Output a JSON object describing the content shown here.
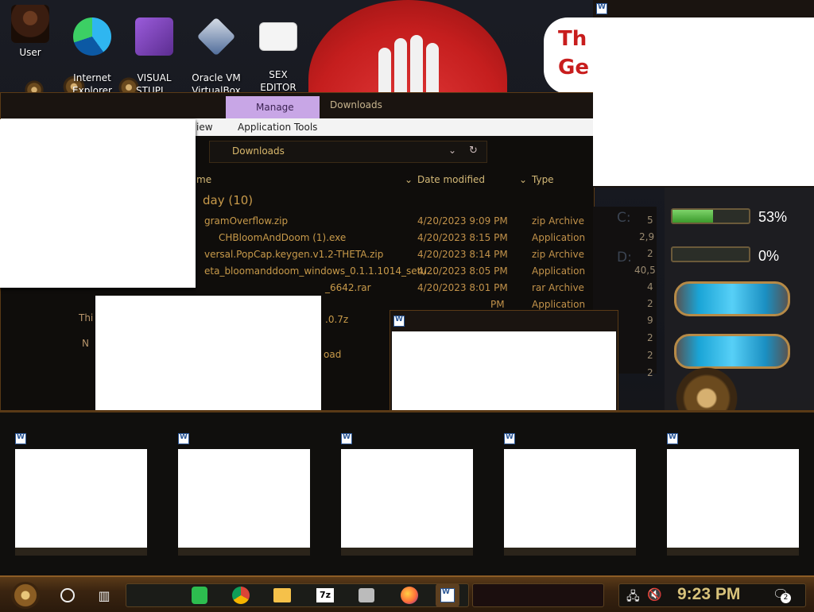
{
  "desktop": {
    "icons": [
      {
        "label": "User",
        "icon": "user-icon"
      },
      {
        "label": "Internet\nExplorer",
        "icon": "edge-icon"
      },
      {
        "label": "VISUAL\nSTUPI...",
        "icon": "visual-studio-icon"
      },
      {
        "label": "Oracle VM\nVirtualBox",
        "icon": "virtualbox-icon"
      },
      {
        "label": "SEX\nEDITOR",
        "icon": "hxd-icon"
      }
    ],
    "sign_text_1": "Th",
    "sign_text_2": "Ge"
  },
  "explorer": {
    "ribbon": {
      "manage_tab": "Manage",
      "downloads_tab": "Downloads",
      "view_tab": "iew",
      "app_tools_tab": "Application Tools"
    },
    "address": {
      "path": "Downloads"
    },
    "columns": {
      "name": "me",
      "date": "Date modified",
      "type": "Type"
    },
    "group_header": "day (10)",
    "files": [
      {
        "name": "gramOverflow.zip",
        "date": "4/20/2023 9:09 PM",
        "type": "zip Archive",
        "size": "5"
      },
      {
        "name": "CHBloomAndDoom (1).exe",
        "date": "4/20/2023 8:15 PM",
        "type": "Application",
        "size": "2,9"
      },
      {
        "name": "versal.PopCap.keygen.v1.2-THETA.zip",
        "date": "4/20/2023 8:14 PM",
        "type": "zip Archive",
        "size": "2"
      },
      {
        "name": "eta_bloomanddoom_windows_0.1.1.1014_setu...",
        "date": "4/20/2023 8:05 PM",
        "type": "Application",
        "size": "40,5"
      },
      {
        "name": "_6642.rar",
        "date": "4/20/2023 8:01 PM",
        "type": "rar Archive",
        "size": "4"
      },
      {
        "name": "",
        "date": "PM",
        "type": "Application",
        "size": "2"
      }
    ],
    "extra_rows": [
      {
        "name": ".0.7z",
        "size": "9"
      },
      {
        "name": "oad",
        "size": "2"
      },
      {
        "name": "",
        "size": "2"
      },
      {
        "name": "",
        "size": "2"
      }
    ],
    "nav": {
      "this_pc": "Thi",
      "network": "N"
    }
  },
  "gauges": {
    "drives": [
      {
        "letter": "C:",
        "percent_label": "53%",
        "fill_fraction": 0.53
      },
      {
        "letter": "D:",
        "percent_label": "0%",
        "fill_fraction": 0.0
      }
    ]
  },
  "taskview": {
    "thumbnails": [
      {
        "icon": "word-doc-icon"
      },
      {
        "icon": "word-doc-icon"
      },
      {
        "icon": "word-doc-icon"
      },
      {
        "icon": "word-doc-icon"
      },
      {
        "icon": "word-doc-icon"
      }
    ]
  },
  "taskbar": {
    "clock": "9:23 PM",
    "notification_count": "2",
    "apps": [
      "spotify-icon",
      "chrome-icon",
      "file-explorer-icon",
      "7zip-icon",
      "wine-icon",
      "firefox-icon",
      "word-icon"
    ],
    "colors": {
      "accent": "#d8c27a",
      "brass": "#8c5c25"
    }
  }
}
